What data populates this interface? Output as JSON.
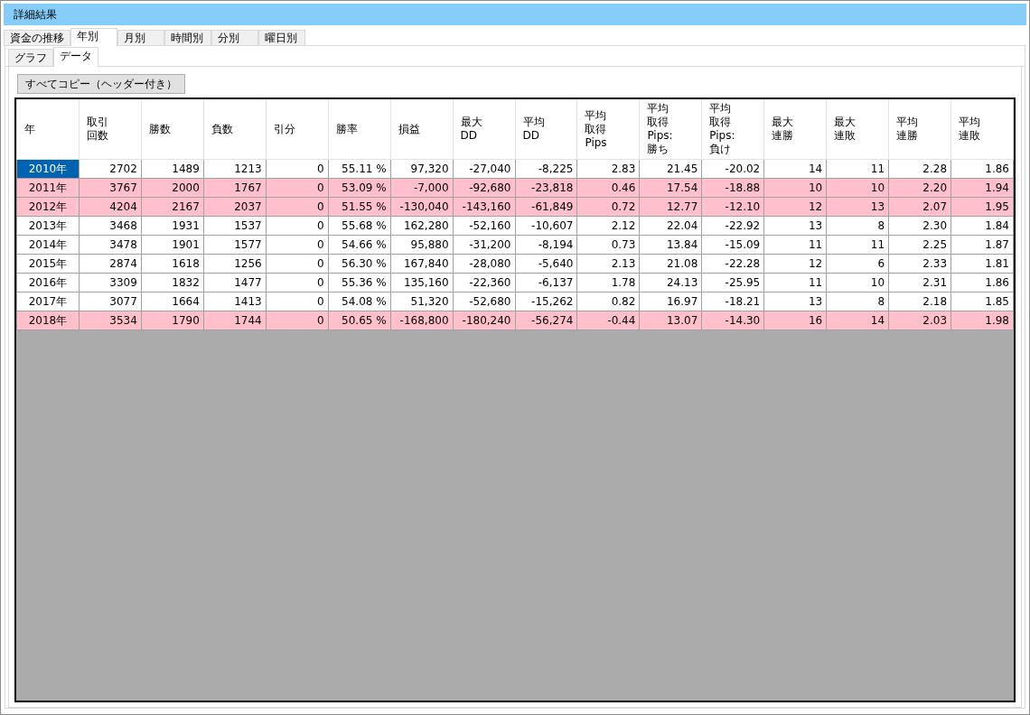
{
  "window": {
    "title": "詳細結果"
  },
  "tabs": [
    {
      "label": "資金の推移",
      "selected": false
    },
    {
      "label": "年別",
      "selected": true
    },
    {
      "label": "月別",
      "selected": false
    },
    {
      "label": "時間別",
      "selected": false
    },
    {
      "label": "分別",
      "selected": false
    },
    {
      "label": "曜日別",
      "selected": false
    }
  ],
  "subtabs": [
    {
      "label": "グラフ",
      "selected": false
    },
    {
      "label": "データ",
      "selected": true
    }
  ],
  "copy_button": "すべてコピー（ヘッダー付き）",
  "table": {
    "columns": [
      "年",
      "取引回数",
      "勝数",
      "負数",
      "引分",
      "勝率",
      "損益",
      "最大\nDD",
      "平均\nDD",
      "平均取得Pips",
      "平均取得Pips:勝ち",
      "平均取得Pips:負け",
      "最大連勝",
      "最大連敗",
      "平均連勝",
      "平均連敗"
    ],
    "rows": [
      {
        "selected": true,
        "highlighted": false,
        "cells": [
          "2010年",
          "2702",
          "1489",
          "1213",
          "0",
          "55.11 %",
          "97,320",
          "-27,040",
          "-8,225",
          "2.83",
          "21.45",
          "-20.02",
          "14",
          "11",
          "2.28",
          "1.86"
        ]
      },
      {
        "selected": false,
        "highlighted": true,
        "cells": [
          "2011年",
          "3767",
          "2000",
          "1767",
          "0",
          "53.09 %",
          "-7,000",
          "-92,680",
          "-23,818",
          "0.46",
          "17.54",
          "-18.88",
          "10",
          "10",
          "2.20",
          "1.94"
        ]
      },
      {
        "selected": false,
        "highlighted": true,
        "cells": [
          "2012年",
          "4204",
          "2167",
          "2037",
          "0",
          "51.55 %",
          "-130,040",
          "-143,160",
          "-61,849",
          "0.72",
          "12.77",
          "-12.10",
          "12",
          "13",
          "2.07",
          "1.95"
        ]
      },
      {
        "selected": false,
        "highlighted": false,
        "cells": [
          "2013年",
          "3468",
          "1931",
          "1537",
          "0",
          "55.68 %",
          "162,280",
          "-52,160",
          "-10,607",
          "2.12",
          "22.04",
          "-22.92",
          "13",
          "8",
          "2.30",
          "1.84"
        ]
      },
      {
        "selected": false,
        "highlighted": false,
        "cells": [
          "2014年",
          "3478",
          "1901",
          "1577",
          "0",
          "54.66 %",
          "95,880",
          "-31,200",
          "-8,194",
          "0.73",
          "13.84",
          "-15.09",
          "11",
          "11",
          "2.25",
          "1.87"
        ]
      },
      {
        "selected": false,
        "highlighted": false,
        "cells": [
          "2015年",
          "2874",
          "1618",
          "1256",
          "0",
          "56.30 %",
          "167,840",
          "-28,080",
          "-5,640",
          "2.13",
          "21.08",
          "-22.28",
          "12",
          "6",
          "2.33",
          "1.81"
        ]
      },
      {
        "selected": false,
        "highlighted": false,
        "cells": [
          "2016年",
          "3309",
          "1832",
          "1477",
          "0",
          "55.36 %",
          "135,160",
          "-22,360",
          "-6,137",
          "1.78",
          "24.13",
          "-25.95",
          "11",
          "10",
          "2.31",
          "1.86"
        ]
      },
      {
        "selected": false,
        "highlighted": false,
        "cells": [
          "2017年",
          "3077",
          "1664",
          "1413",
          "0",
          "54.08 %",
          "51,320",
          "-52,680",
          "-15,262",
          "0.82",
          "16.97",
          "-18.21",
          "13",
          "8",
          "2.18",
          "1.85"
        ]
      },
      {
        "selected": false,
        "highlighted": true,
        "cells": [
          "2018年",
          "3534",
          "1790",
          "1744",
          "0",
          "50.65 %",
          "-168,800",
          "-180,240",
          "-56,274",
          "-0.44",
          "13.07",
          "-14.30",
          "16",
          "14",
          "2.03",
          "1.98"
        ]
      }
    ]
  }
}
